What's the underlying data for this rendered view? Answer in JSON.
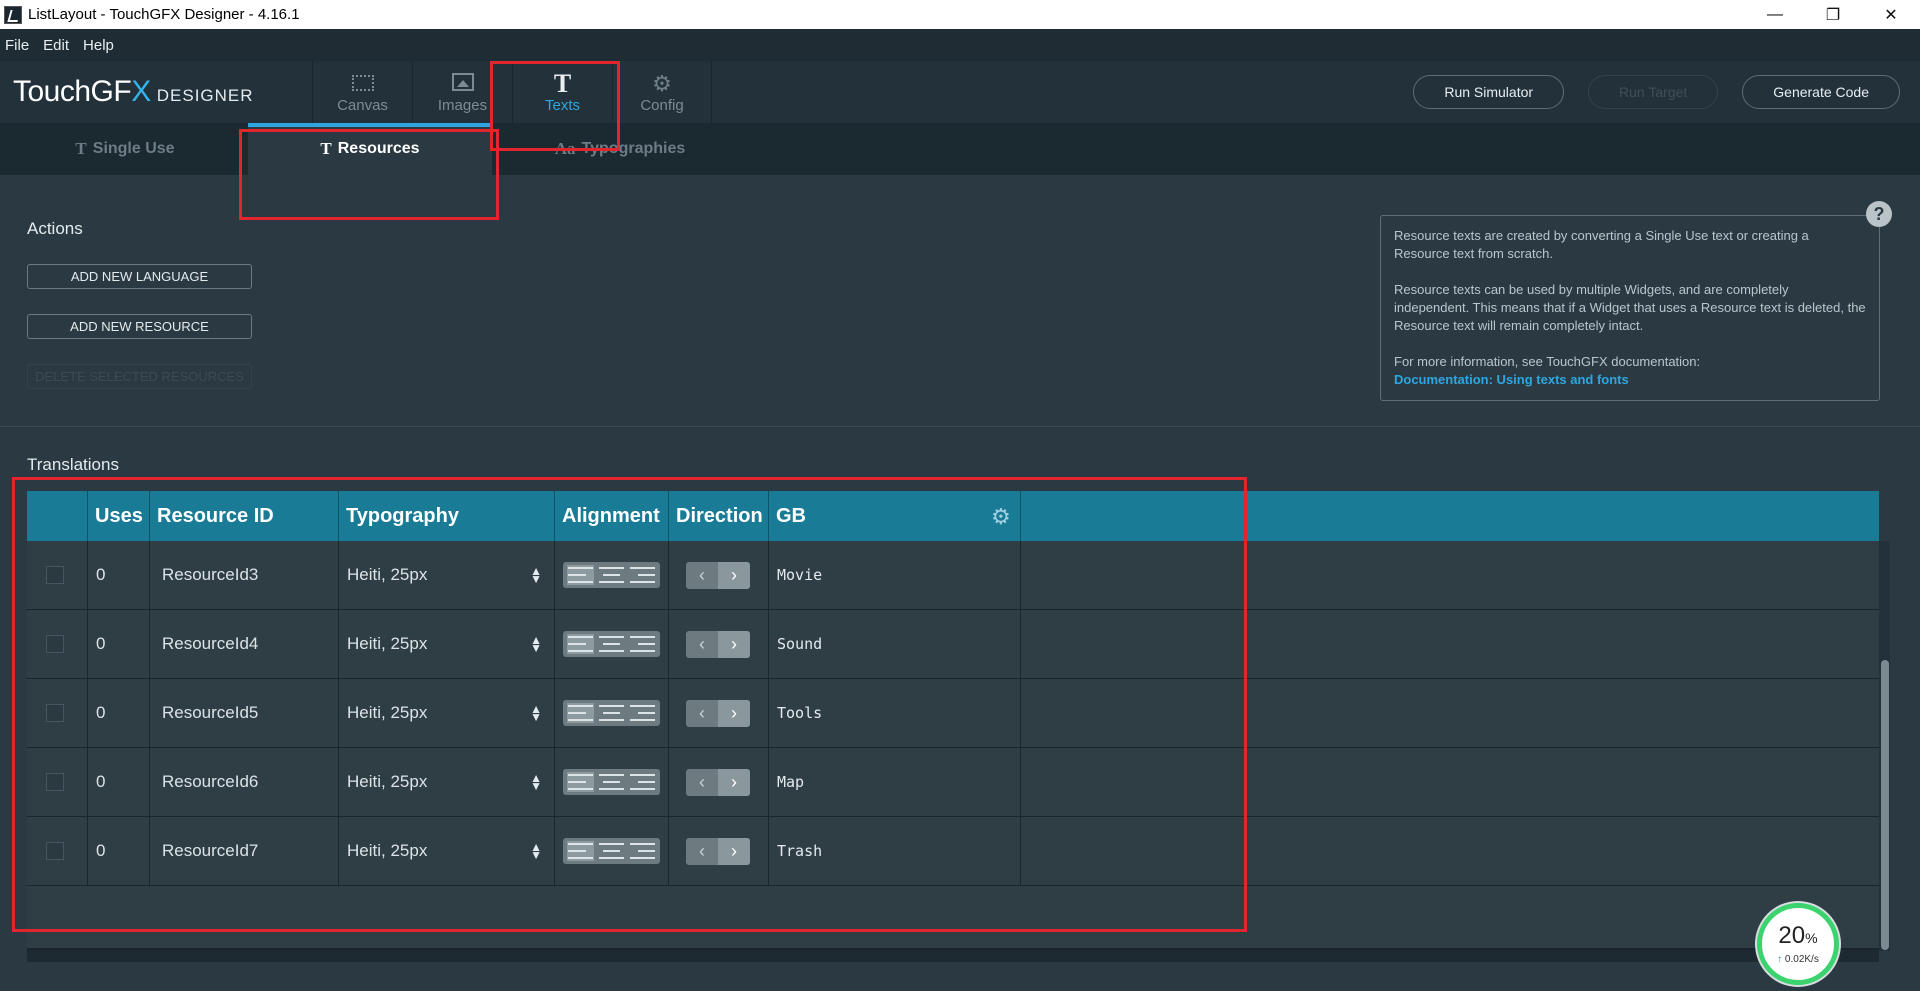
{
  "window": {
    "title": "ListLayout - TouchGFX Designer - 4.16.1",
    "controls": [
      "—",
      "❐",
      "✕"
    ]
  },
  "menu": [
    "File",
    "Edit",
    "Help"
  ],
  "logo": {
    "main_a": "TouchGF",
    "main_x": "X",
    "sub": "DESIGNER"
  },
  "main_tabs": [
    {
      "label": "Canvas",
      "icon": "canvas-icon"
    },
    {
      "label": "Images",
      "icon": "image-icon"
    },
    {
      "label": "Texts",
      "icon": "text-t-icon",
      "glyph": "T"
    },
    {
      "label": "Config",
      "icon": "gear-icon",
      "glyph": "⚙"
    }
  ],
  "top_actions": {
    "run_simulator": "Run Simulator",
    "run_target": "Run Target",
    "generate_code": "Generate Code"
  },
  "sub_tabs": [
    {
      "label": "Single Use",
      "glyph": "T"
    },
    {
      "label": "Resources",
      "glyph": "T"
    },
    {
      "label": "Typographies",
      "glyph": "Aa"
    }
  ],
  "actions": {
    "title": "Actions",
    "add_language": "ADD NEW LANGUAGE",
    "add_resource": "ADD NEW RESOURCE",
    "delete_selected": "DELETE SELECTED RESOURCES"
  },
  "info": {
    "p1": "Resource texts are created by converting a Single Use text or creating a Resource text from scratch.",
    "p2": "Resource texts can be used by multiple Widgets, and are completely independent. This means that if a Widget that uses a Resource text is deleted, the Resource text will remain completely intact.",
    "p3": "For more information, see TouchGFX documentation:",
    "link": "Documentation: Using texts and fonts",
    "help": "?"
  },
  "translations": {
    "title": "Translations",
    "headers": {
      "uses": "Uses",
      "resource_id": "Resource ID",
      "typography": "Typography",
      "alignment": "Alignment",
      "direction": "Direction",
      "language": "GB"
    },
    "rows": [
      {
        "uses": "0",
        "id": "ResourceId3",
        "typography": "Heiti, 25px",
        "text": "Movie"
      },
      {
        "uses": "0",
        "id": "ResourceId4",
        "typography": "Heiti, 25px",
        "text": "Sound"
      },
      {
        "uses": "0",
        "id": "ResourceId5",
        "typography": "Heiti, 25px",
        "text": "Tools"
      },
      {
        "uses": "0",
        "id": "ResourceId6",
        "typography": "Heiti, 25px",
        "text": "Map"
      },
      {
        "uses": "0",
        "id": "ResourceId7",
        "typography": "Heiti, 25px",
        "text": "Trash"
      }
    ]
  },
  "net_widget": {
    "percent": "20",
    "percent_sign": "%",
    "speed": "0.02K/s"
  },
  "colors": {
    "accent": "#2ea6e0",
    "header": "#1a7b96",
    "annotation": "#e3262d",
    "widget_ring": "#3bd36e"
  }
}
